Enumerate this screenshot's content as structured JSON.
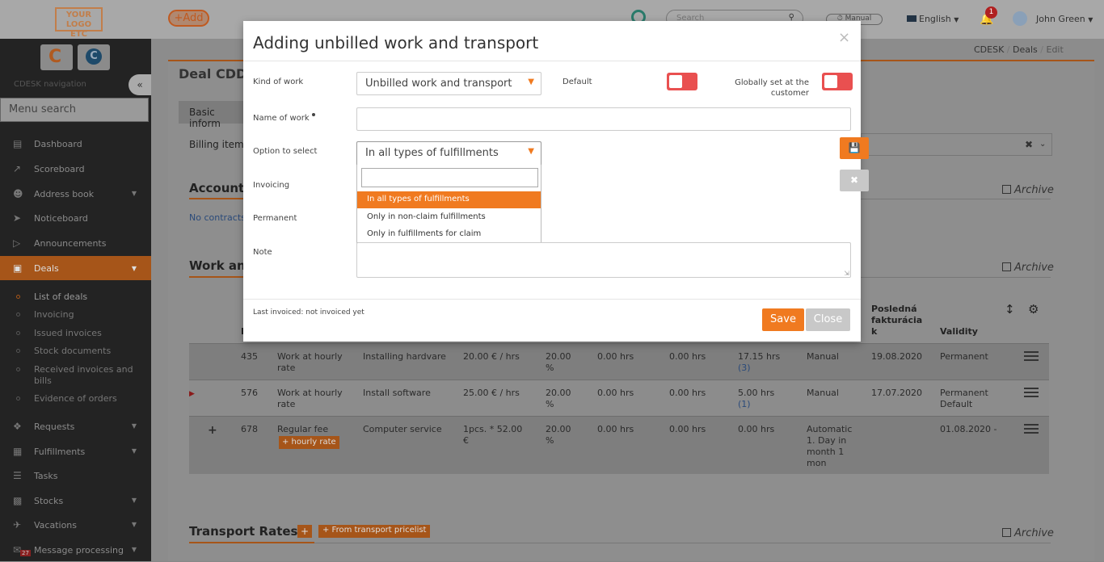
{
  "topbar": {
    "logo_line1": "YOUR LOGO",
    "logo_line2": "ETC",
    "add_label": "+Add",
    "search_placeholder": "Search",
    "manual_label": "Manual",
    "language": "English",
    "notifications_count": "1",
    "user_name": "John Green"
  },
  "sidebar": {
    "nav_title": "CDESK navigation",
    "menu_search_placeholder": "Menu search",
    "items": [
      {
        "label": "Dashboard",
        "icon": "dashboard-icon"
      },
      {
        "label": "Scoreboard",
        "icon": "chart-icon"
      },
      {
        "label": "Address book",
        "icon": "user-icon"
      },
      {
        "label": "Noticeboard",
        "icon": "paper-plane-icon"
      },
      {
        "label": "Announcements",
        "icon": "bullhorn-icon"
      },
      {
        "label": "Deals",
        "icon": "briefcase-icon"
      }
    ],
    "deals_sub": [
      "List of deals",
      "Invoicing",
      "Issued invoices",
      "Stock documents",
      "Received invoices and bills",
      "Evidence of orders"
    ],
    "items_after": [
      {
        "label": "Requests",
        "icon": "dropbox-icon"
      },
      {
        "label": "Fulfillments",
        "icon": "cube-icon"
      },
      {
        "label": "Tasks",
        "icon": "tasks-icon"
      },
      {
        "label": "Stocks",
        "icon": "cubes-icon"
      },
      {
        "label": "Vacations",
        "icon": "plane-icon"
      },
      {
        "label": "Message processing",
        "icon": "envelope-icon"
      }
    ],
    "message_badge": "27"
  },
  "breadcrumb": [
    "CDESK",
    "Deals",
    "Edit"
  ],
  "page": {
    "title": "Deal CDD",
    "tab_basic": "Basic inform",
    "billing_item_label": "Billing item",
    "accounting_heading": "Accounti",
    "no_contracts": "No contracts",
    "work_heading": "Work an",
    "archive_label": "Archive",
    "transport_heading": "Transport Rates",
    "transport_button": "+ From transport pricelist",
    "hourly_rate_button": "+ hourly rate"
  },
  "table": {
    "header_last_invoice": "Posledná fakturácia k",
    "header_validity": "Validity",
    "header_id_initial": "I",
    "rows": [
      {
        "id": "435",
        "kind": "Work at hourly rate",
        "name": "Installing hardvare",
        "price": "20.00 € / hrs",
        "vat": "20.00 %",
        "c1": "0.00 hrs",
        "c2": "0.00 hrs",
        "c3": "17.15 hrs",
        "c3b": "(3)",
        "mode": "Manual",
        "last": "19.08.2020",
        "validity": "Permanent",
        "validity2": ""
      },
      {
        "id": "576",
        "kind": "Work at hourly rate",
        "name": "Install software",
        "price": "25.00 € / hrs",
        "vat": "20.00 %",
        "c1": "0.00 hrs",
        "c2": "0.00 hrs",
        "c3": "5.00 hrs",
        "c3b": "(1)",
        "mode": "Manual",
        "last": "17.07.2020",
        "validity": "Permanent",
        "validity2": "Default"
      },
      {
        "id": "678",
        "kind": "Regular fee",
        "name": "Computer service",
        "price": "1pcs. * 52.00 €",
        "vat": "20.00 %",
        "c1": "0.00 hrs",
        "c2": "0.00 hrs",
        "c3": "0.00 hrs",
        "c3b": "",
        "mode": "Automatic 1. Day in month 1 mon",
        "last": "",
        "validity": "01.08.2020 -",
        "validity2": ""
      }
    ]
  },
  "modal": {
    "title": "Adding unbilled work and transport",
    "kind_of_work_label": "Kind of work",
    "kind_of_work_value": "Unbilled work and transport",
    "default_label": "Default",
    "globally_label": "Globally set at the customer",
    "name_of_work_label": "Name of work",
    "option_label": "Option to select",
    "option_value": "In all types of fulfillments",
    "invoicing_label": "Invoicing",
    "permanent_label": "Permanent",
    "note_label": "Note",
    "options": [
      "In all types of fulfillments",
      "Only in non-claim fulfillments",
      "Only in fulfillments for claim"
    ],
    "last_invoiced": "Last invoiced: not invoiced yet",
    "save_label": "Save",
    "close_label": "Close"
  },
  "colors": {
    "accent": "#f07a20",
    "toggle_off": "#e95050"
  }
}
